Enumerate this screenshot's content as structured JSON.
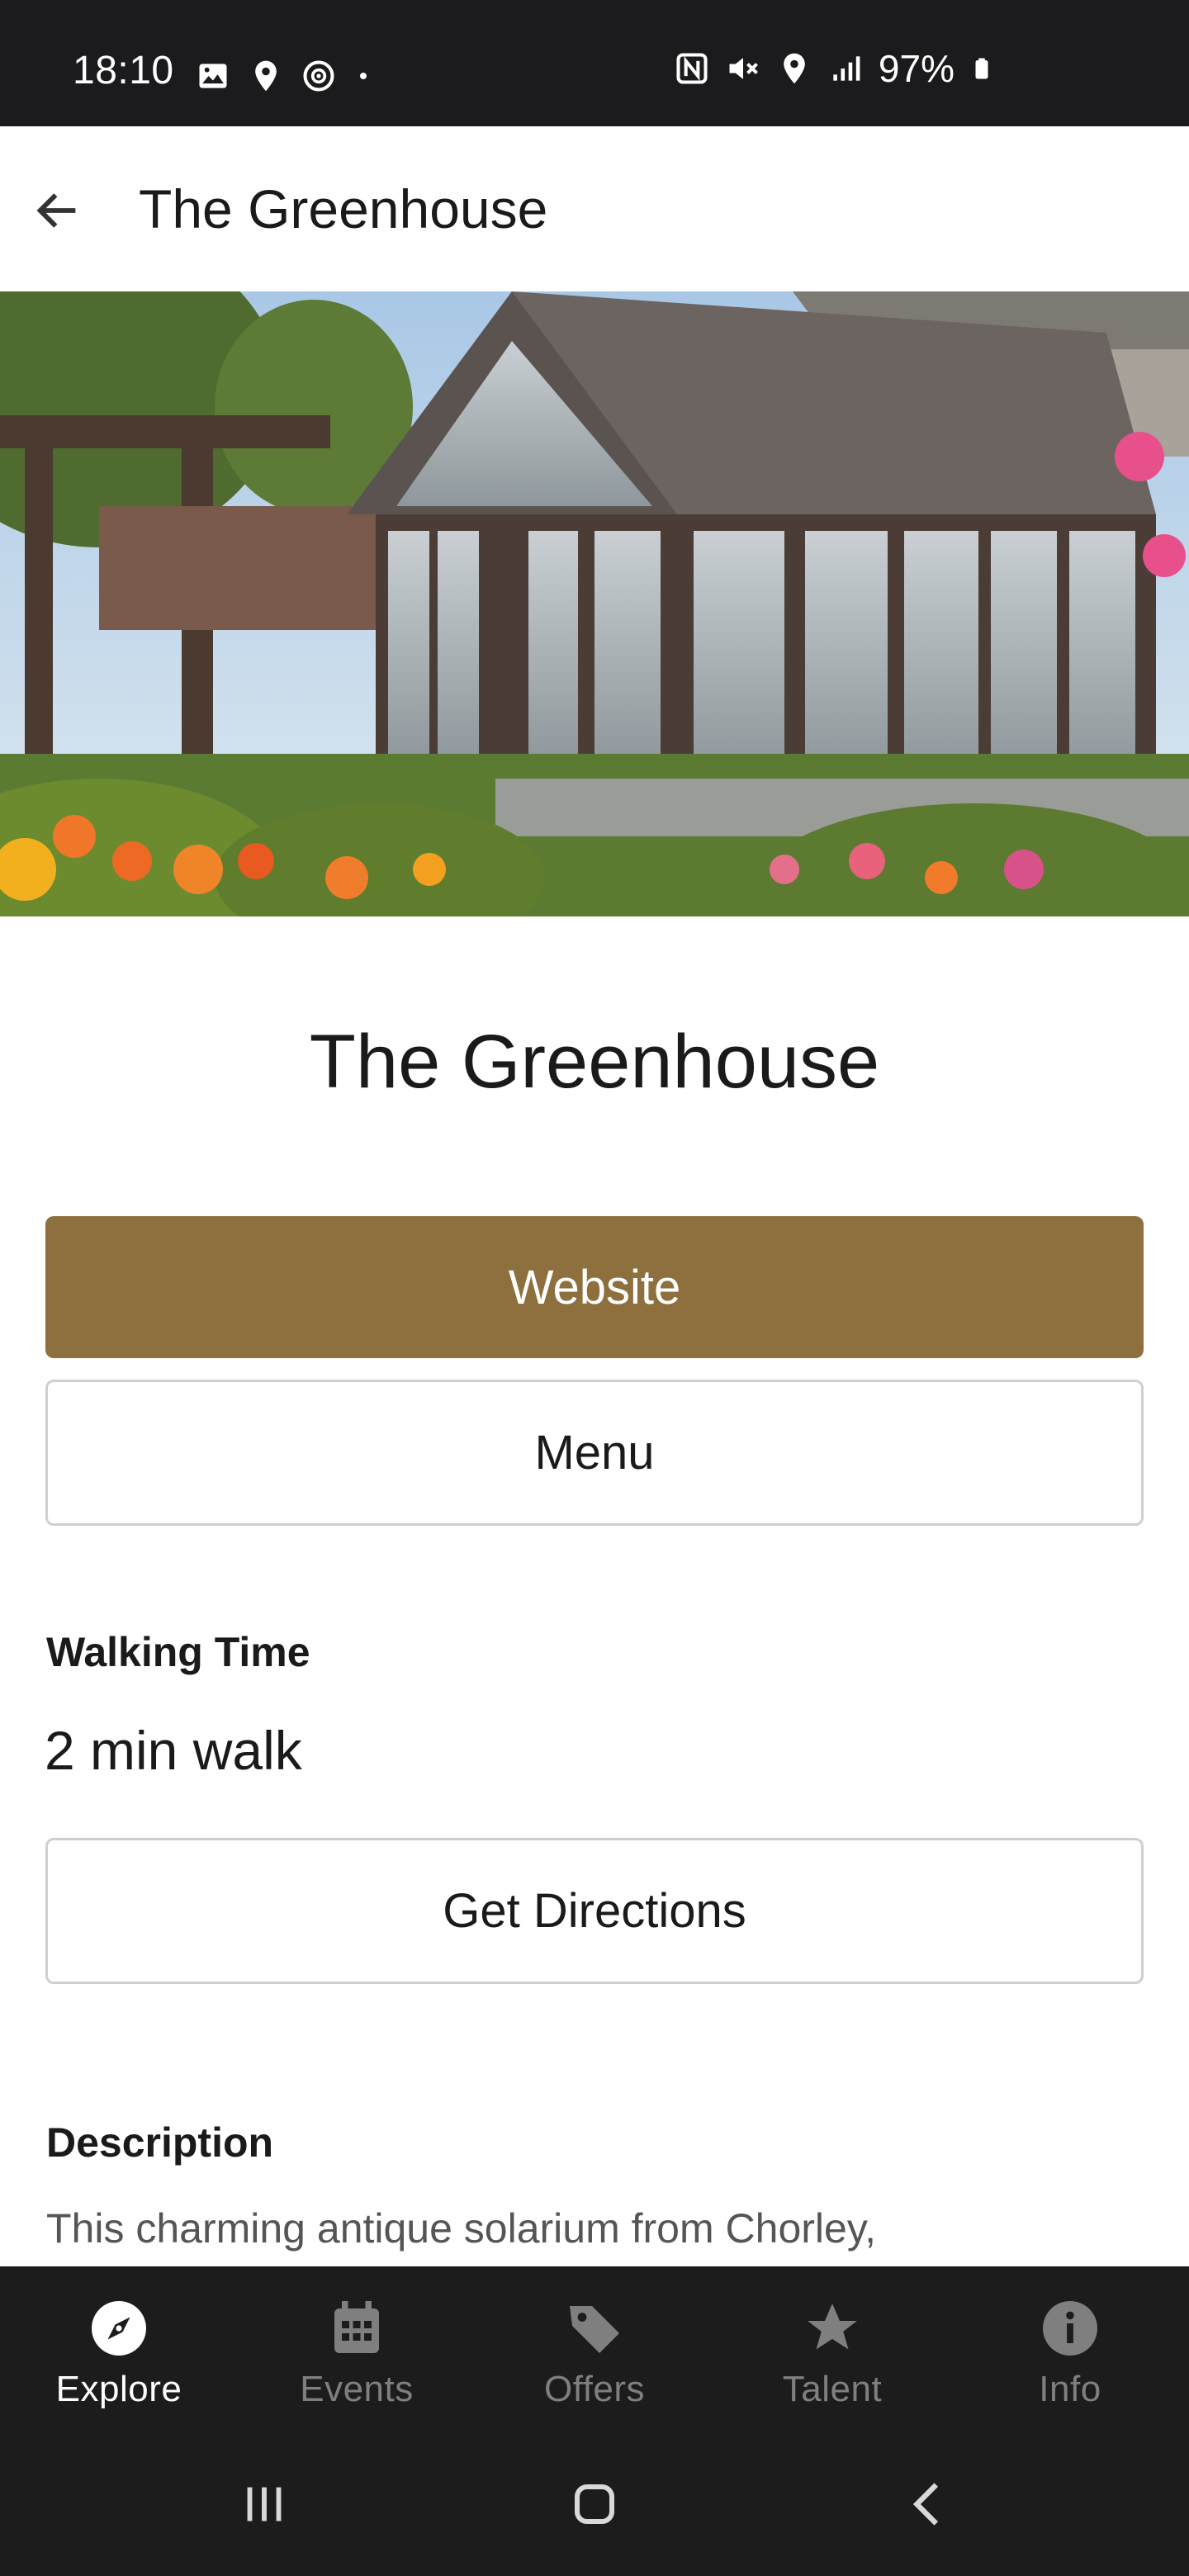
{
  "status_bar": {
    "time": "18:10",
    "battery": "97%",
    "left_icons": [
      "gallery-icon",
      "location-pin-icon",
      "sync-icon",
      "dot-icon"
    ],
    "right_icons": [
      "nfc-icon",
      "mute-icon",
      "location-icon",
      "signal-icon",
      "battery-icon"
    ]
  },
  "app_bar": {
    "title": "The Greenhouse",
    "back_icon": "arrow-left-icon"
  },
  "hero": {
    "alt": "greenhouse-photo"
  },
  "place": {
    "name": "The Greenhouse",
    "website_label": "Website",
    "menu_label": "Menu"
  },
  "walking": {
    "label": "Walking Time",
    "value": "2 min walk",
    "directions_label": "Get Directions"
  },
  "description": {
    "label": "Description",
    "text": "This charming antique solarium from Chorley,"
  },
  "bottom_nav": {
    "items": [
      {
        "label": "Explore",
        "icon": "compass-icon",
        "active": true
      },
      {
        "label": "Events",
        "icon": "calendar-icon",
        "active": false
      },
      {
        "label": "Offers",
        "icon": "tag-icon",
        "active": false
      },
      {
        "label": "Talent",
        "icon": "star-icon",
        "active": false
      },
      {
        "label": "Info",
        "icon": "info-icon",
        "active": false
      }
    ]
  },
  "colors": {
    "accent": "#8e6f3e",
    "nav_bg": "#1c1c1c",
    "nav_inactive": "#7f7f7f"
  }
}
